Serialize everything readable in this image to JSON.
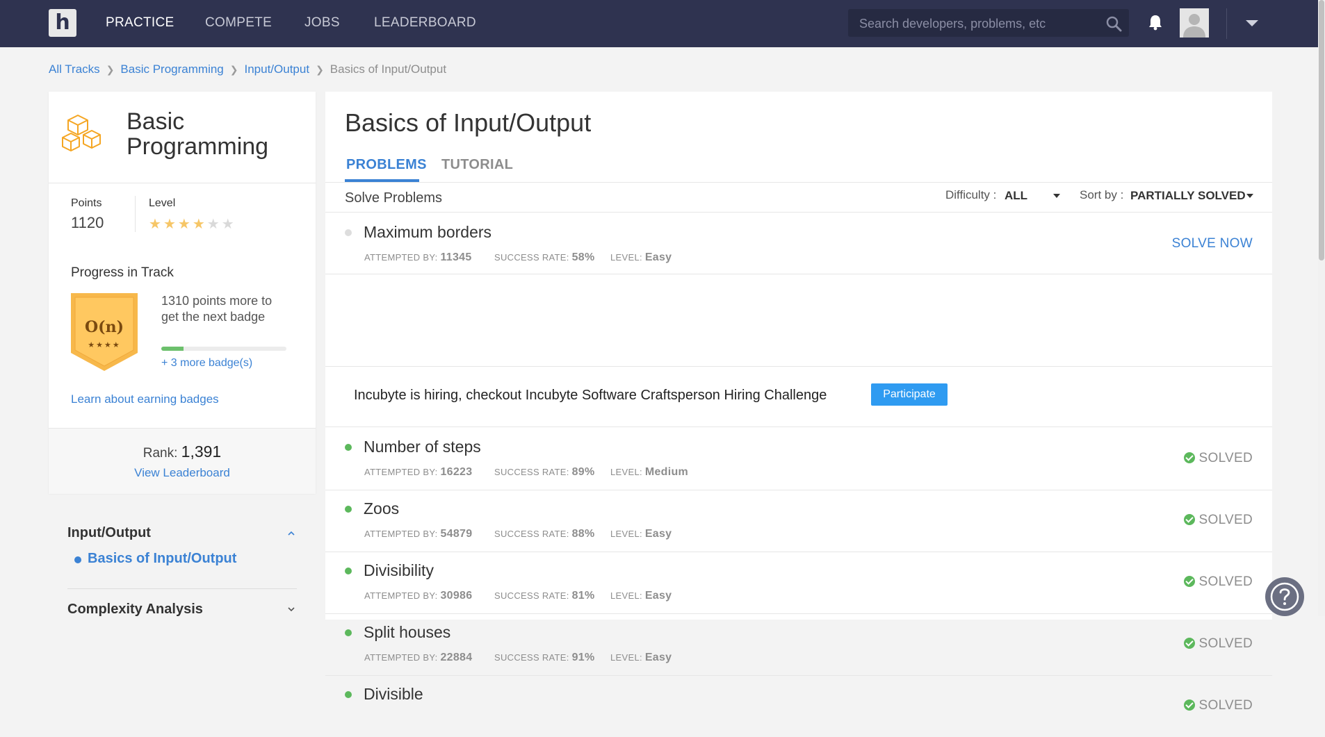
{
  "nav": {
    "logo": "h",
    "links": [
      "PRACTICE",
      "COMPETE",
      "JOBS",
      "LEADERBOARD"
    ],
    "search_placeholder": "Search developers, problems, etc"
  },
  "breadcrumb": [
    "All Tracks",
    "Basic Programming",
    "Input/Output",
    "Basics of Input/Output"
  ],
  "track": {
    "title": "Basic Programming",
    "points_label": "Points",
    "points": "1120",
    "level_label": "Level",
    "level_stars": 4,
    "level_max": 6,
    "progress_title": "Progress in Track",
    "badge_symbol": "O(n)",
    "badge_stars": "★★★★",
    "badge_text": "1310 points more to get the next badge",
    "badge_progress": 0.18,
    "more_badges": "+ 3 more badge(s)",
    "learn_link": "Learn about earning badges",
    "rank_label": "Rank:",
    "rank_value": "1,391",
    "view_leaderboard": "View Leaderboard"
  },
  "sidebar_sections": [
    {
      "title": "Input/Output",
      "expanded": true,
      "items": [
        "Basics of Input/Output"
      ]
    },
    {
      "title": "Complexity Analysis",
      "expanded": false
    }
  ],
  "main": {
    "title": "Basics of Input/Output",
    "tabs": [
      "PROBLEMS",
      "TUTORIAL"
    ],
    "solve_title": "Solve Problems",
    "difficulty_label": "Difficulty :",
    "difficulty_value": "ALL",
    "sort_label": "Sort by :",
    "sort_value": "PARTIALLY SOLVED",
    "meta_labels": {
      "attempted": "ATTEMPTED BY:",
      "success": "SUCCESS RATE:",
      "level": "LEVEL:"
    },
    "solve_now": "SOLVE NOW",
    "solved": "SOLVED",
    "hiring_text": "Incubyte is hiring, checkout Incubyte Software Craftsperson Hiring Challenge",
    "participate": "Participate",
    "problems": [
      {
        "name": "Maximum borders",
        "attempted": "11345",
        "success": "58%",
        "level": "Easy",
        "solved": false
      },
      {
        "name": "Number of steps",
        "attempted": "16223",
        "success": "89%",
        "level": "Medium",
        "solved": true
      },
      {
        "name": "Zoos",
        "attempted": "54879",
        "success": "88%",
        "level": "Easy",
        "solved": true
      },
      {
        "name": "Divisibility",
        "attempted": "30986",
        "success": "81%",
        "level": "Easy",
        "solved": true
      },
      {
        "name": "Split houses",
        "attempted": "22884",
        "success": "91%",
        "level": "Easy",
        "solved": true
      },
      {
        "name": "Divisible",
        "attempted": "",
        "success": "",
        "level": "",
        "solved": true
      }
    ]
  },
  "colors": {
    "nav_bg": "#2f3350",
    "accent": "#3b82d4",
    "solved_green": "#5cb85c",
    "star": "#f6c667",
    "badge_orange": "#f7b84b",
    "participate_bg": "#2f9bf1"
  }
}
